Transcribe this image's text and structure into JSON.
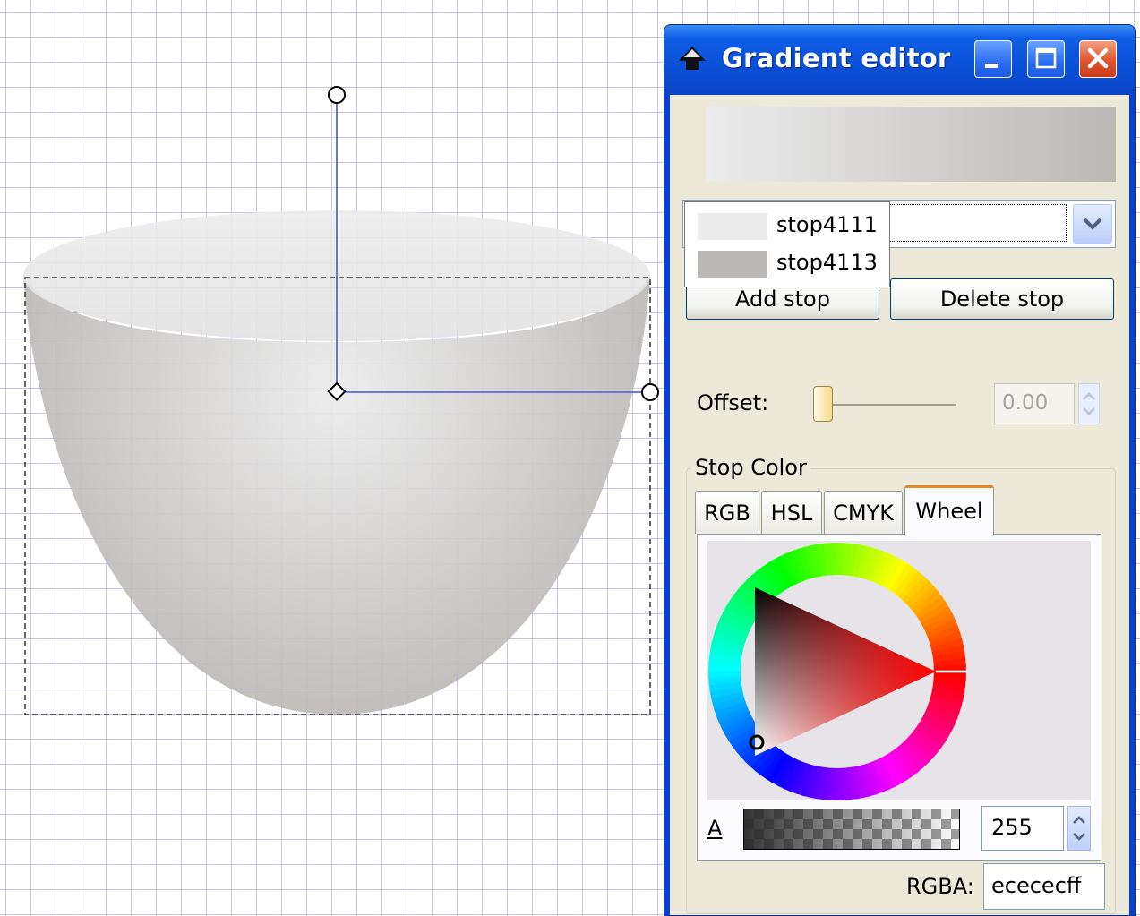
{
  "canvas": {
    "object": "bowl-shape",
    "colors": {
      "light": "#ececec",
      "dark": "#bbb8b6",
      "handle": "#6a78d8"
    }
  },
  "dialog": {
    "title": "Gradient editor",
    "stops": [
      {
        "label": "stop4111",
        "color": "#ececec"
      },
      {
        "label": "stop4113",
        "color": "#bbb8b6"
      }
    ],
    "add_stop_label": "Add stop",
    "delete_stop_label": "Delete stop",
    "offset_label": "Offset:",
    "offset_value": "0.00",
    "stop_color_label": "Stop Color",
    "tabs": [
      "RGB",
      "HSL",
      "CMYK",
      "Wheel"
    ],
    "active_tab": "Wheel",
    "alpha_label": "A",
    "alpha_value": "255",
    "rgba_label": "RGBA:",
    "rgba_value": "ecececff",
    "icons": [
      "app-icon",
      "minimize-icon",
      "maximize-icon",
      "close-icon",
      "chevron-down-icon",
      "spin-arrows-icon"
    ]
  }
}
